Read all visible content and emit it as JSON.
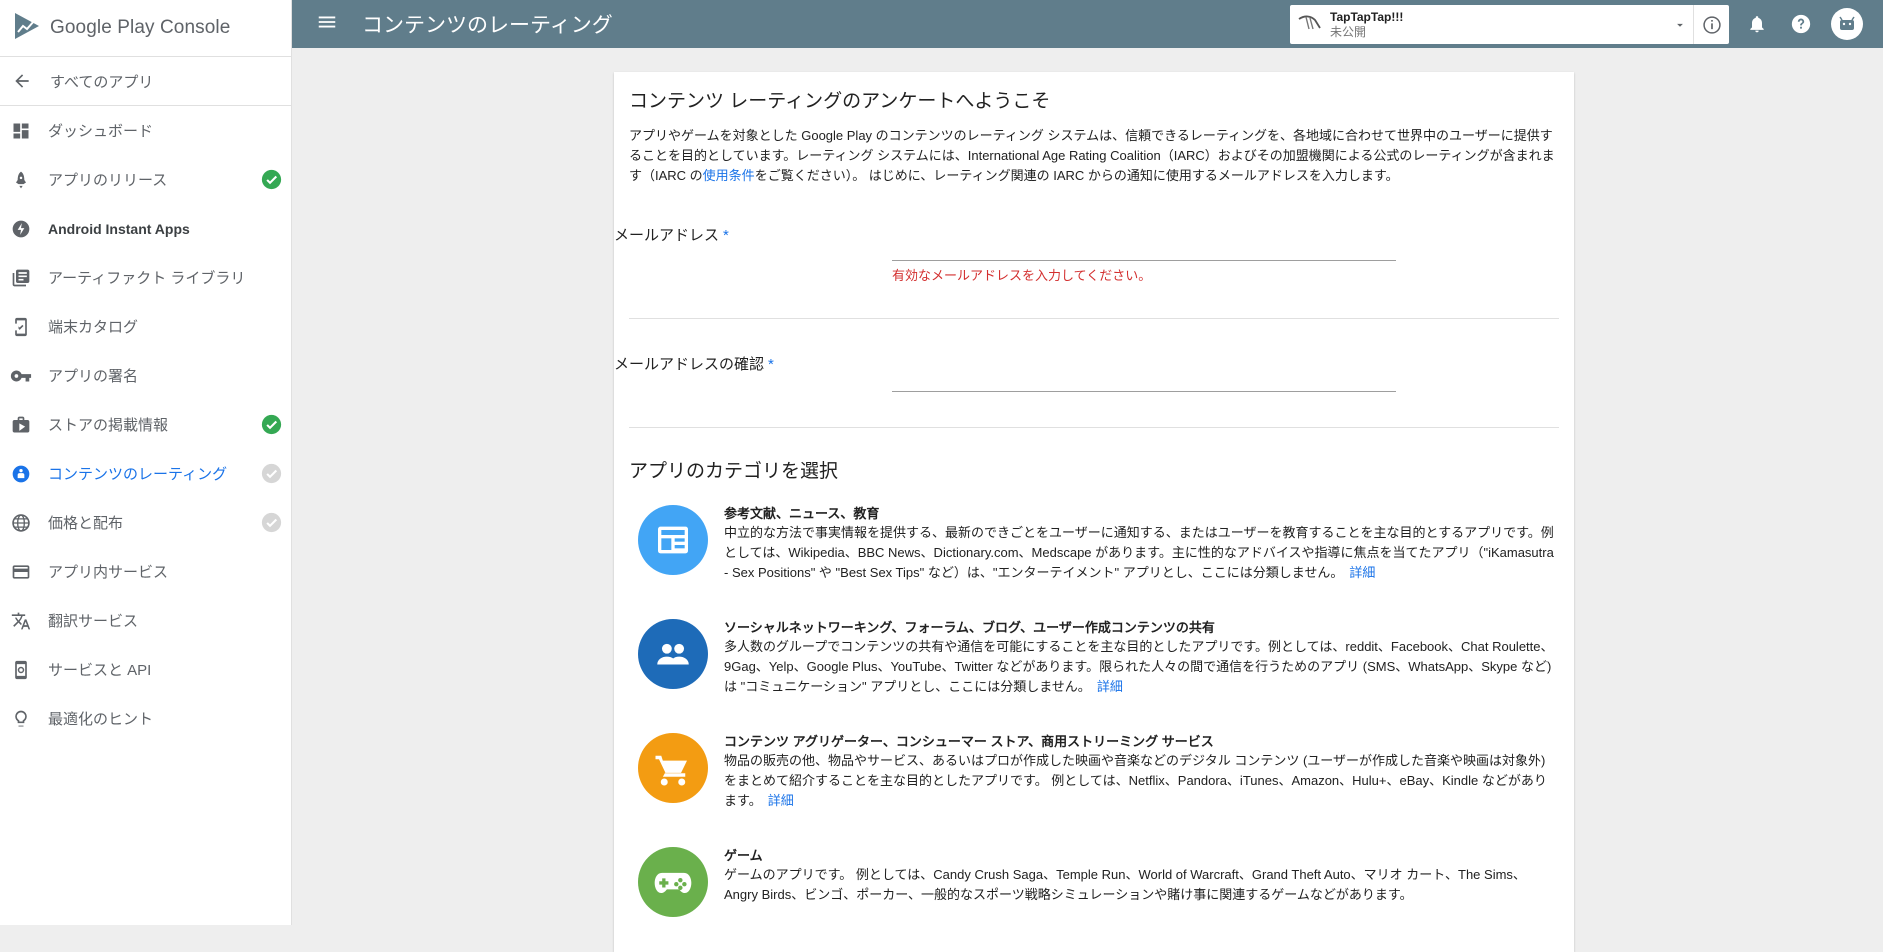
{
  "app": {
    "brand": "Google Play Console",
    "page_title": "コンテンツのレーティング"
  },
  "selector": {
    "app_name": "TapTapTap!!!",
    "status": "未公開"
  },
  "sidebar": {
    "back_label": "すべてのアプリ",
    "items": [
      {
        "label": "ダッシュボード",
        "icon": "dashboard-icon",
        "status": "none"
      },
      {
        "label": "アプリのリリース",
        "icon": "rocket-icon",
        "status": "complete"
      },
      {
        "label": "Android Instant Apps",
        "icon": "bolt-icon",
        "status": "none"
      },
      {
        "label": "アーティファクト ライブラリ",
        "icon": "library-icon",
        "status": "none"
      },
      {
        "label": "端末カタログ",
        "icon": "device-icon",
        "status": "none"
      },
      {
        "label": "アプリの署名",
        "icon": "key-icon",
        "status": "none"
      },
      {
        "label": "ストアの掲載情報",
        "icon": "store-icon",
        "status": "complete"
      },
      {
        "label": "コンテンツのレーティング",
        "icon": "rating-icon",
        "status": "pending"
      },
      {
        "label": "価格と配布",
        "icon": "globe-icon",
        "status": "pending"
      },
      {
        "label": "アプリ内サービス",
        "icon": "card-icon",
        "status": "none"
      },
      {
        "label": "翻訳サービス",
        "icon": "translate-icon",
        "status": "none"
      },
      {
        "label": "サービスと API",
        "icon": "services-icon",
        "status": "none"
      },
      {
        "label": "最適化のヒント",
        "icon": "bulb-icon",
        "status": "none"
      }
    ]
  },
  "card": {
    "title": "コンテンツ レーティングのアンケートへようこそ",
    "intro_before_link": "アプリやゲームを対象とした Google Play のコンテンツのレーティング システムは、信頼できるレーティングを、各地域に合わせて世界中のユーザーに提供することを目的としています。レーティング システムには、International Age Rating Coalition（IARC）およびその加盟機関による公式のレーティングが含まれます（IARC の",
    "intro_link": "使用条件",
    "intro_after_link": "をご覧ください）。 はじめに、レーティング関連の IARC からの通知に使用するメールアドレスを入力します。",
    "email_label": "メールアドレス",
    "email_error": "有効なメールアドレスを入力してください。",
    "email_confirm_label": "メールアドレスの確認",
    "required_mark": "*",
    "category_heading": "アプリのカテゴリを選択"
  },
  "categories": [
    {
      "title": "参考文献、ニュース、教育",
      "desc": "中立的な方法で事実情報を提供する、最新のできごとをユーザーに通知する、またはユーザーを教育することを主な目的とするアプリです。例としては、Wikipedia、BBC News、Dictionary.com、Medscape があります。主に性的なアドバイスや指導に焦点を当てたアプリ（\"iKamasutra - Sex Positions\" や \"Best Sex Tips\" など）は、\"エンターテイメント\" アプリとし、ここには分類しません。",
      "link": "詳細",
      "color": "#42a5f5",
      "icon": "newspaper-icon"
    },
    {
      "title": "ソーシャルネットワーキング、フォーラム、ブログ、ユーザー作成コンテンツの共有",
      "desc": "多人数のグループでコンテンツの共有や通信を可能にすることを主な目的としたアプリです。例としては、reddit、Facebook、Chat Roulette、9Gag、Yelp、Google Plus、YouTube、Twitter などがあります。限られた人々の間で通信を行うためのアプリ (SMS、WhatsApp、Skype など) は \"コミュニケーション\" アプリとし、ここには分類しません。",
      "link": "詳細",
      "color": "#1e6bb8",
      "icon": "people-icon"
    },
    {
      "title": "コンテンツ アグリゲーター、コンシューマー ストア、商用ストリーミング サービス",
      "desc": "物品の販売の他、物品やサービス、あるいはプロが作成した映画や音楽などのデジタル コンテンツ (ユーザーが作成した音楽や映画は対象外) をまとめて紹介することを主な目的としたアプリです。 例としては、Netflix、Pandora、iTunes、Amazon、Hulu+、eBay、Kindle などがあります。",
      "link": "詳細",
      "color": "#f39c12",
      "icon": "cart-icon"
    },
    {
      "title": "ゲーム",
      "desc": "ゲームのアプリです。 例としては、Candy Crush Saga、Temple Run、World of Warcraft、Grand Theft Auto、マリオ カート、The Sims、Angry Birds、ビンゴ、ポーカー、一般的なスポーツ戦略シミュレーションや賭け事に関連するゲームなどがあります。",
      "link": "",
      "color": "#6ab04c",
      "icon": "gamepad-icon"
    }
  ],
  "colors": {
    "topbar": "#607d8b",
    "accent": "#1a73e8",
    "success": "#34a853",
    "error": "#d32f2f"
  }
}
